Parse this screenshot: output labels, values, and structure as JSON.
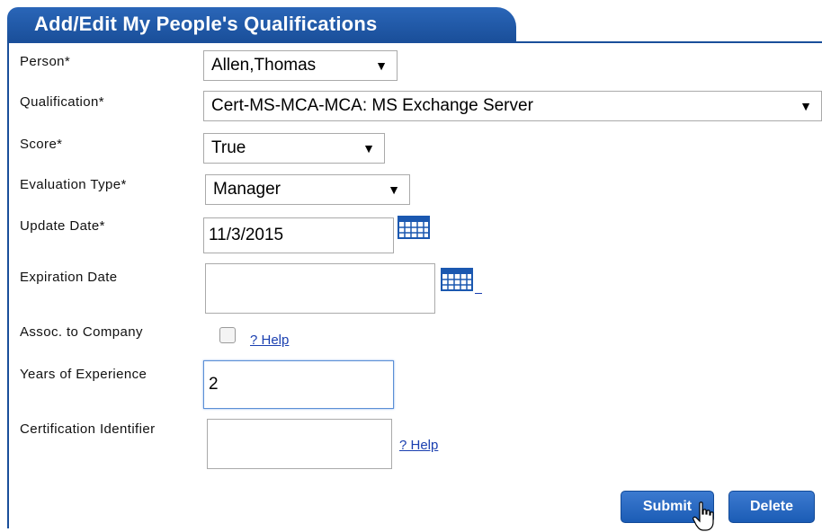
{
  "header": {
    "title": "Add/Edit My People's Qualifications"
  },
  "form": {
    "person": {
      "label": "Person*",
      "value": "Allen,Thomas"
    },
    "qualification": {
      "label": "Qualification*",
      "value": "Cert-MS-MCA-MCA: MS Exchange Server"
    },
    "score": {
      "label": "Score*",
      "value": "True"
    },
    "evaluation_type": {
      "label": "Evaluation Type*",
      "value": "Manager"
    },
    "update_date": {
      "label": "Update Date*",
      "value": "11/3/2015"
    },
    "expiration_date": {
      "label": "Expiration Date",
      "value": ""
    },
    "assoc_company": {
      "label": "Assoc. to Company",
      "checked": false,
      "help": "? Help"
    },
    "years_experience": {
      "label": "Years of Experience",
      "value": "2"
    },
    "cert_identifier": {
      "label": "Certification Identifier",
      "value": "",
      "help": "? Help"
    }
  },
  "buttons": {
    "submit": "Submit",
    "delete": "Delete"
  },
  "icons": {
    "dropdown": "▼",
    "calendar": "calendar-icon"
  },
  "colors": {
    "accent": "#1a4f9a",
    "link": "#1a3fb0"
  }
}
